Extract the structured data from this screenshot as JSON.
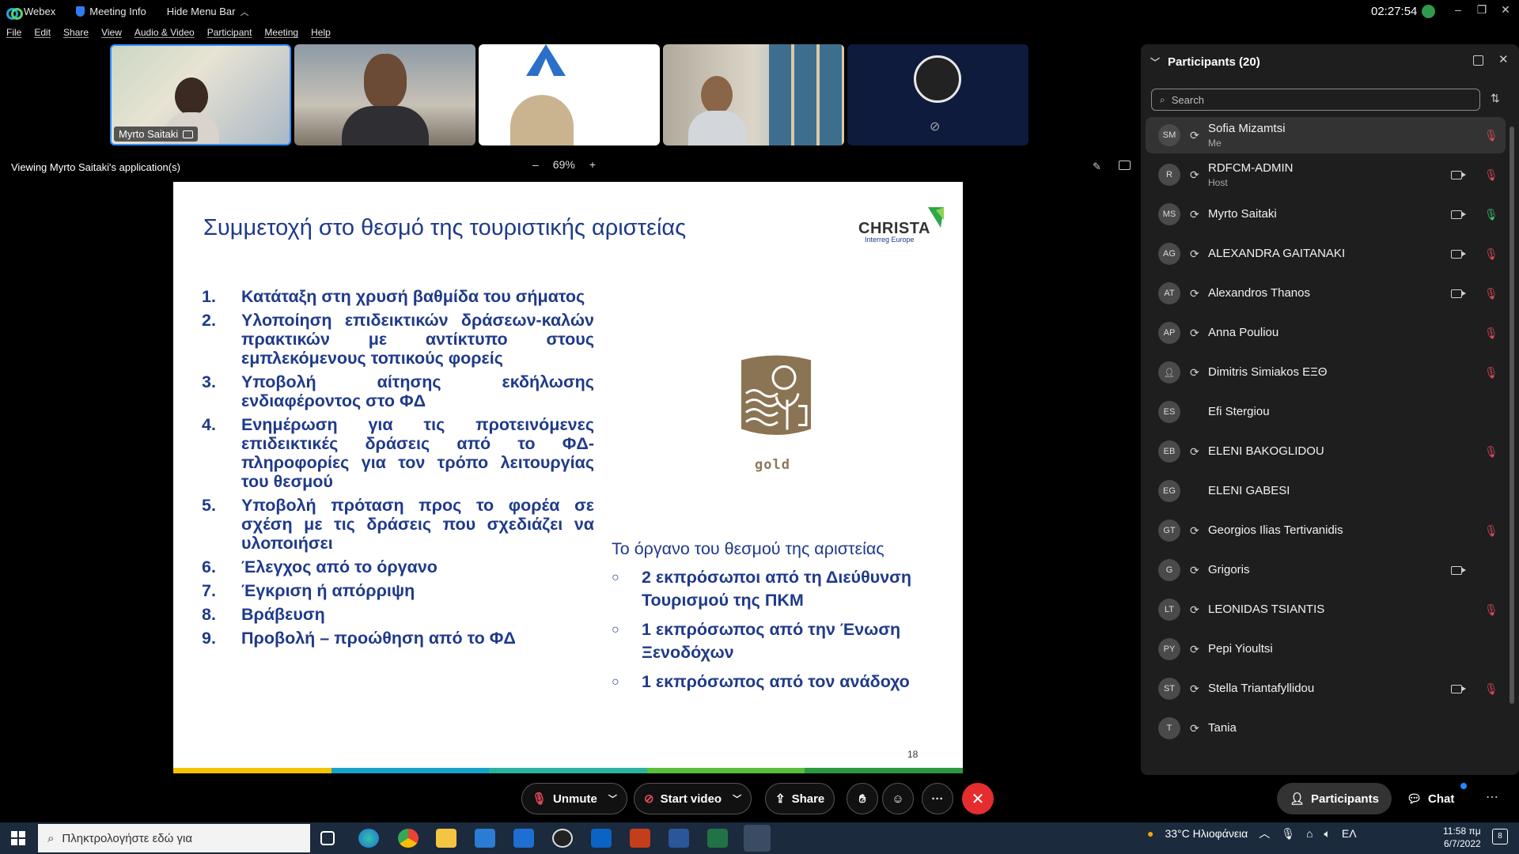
{
  "titlebar": {
    "app_name": "Webex",
    "meeting_info": "Meeting Info",
    "hide_menu": "Hide Menu Bar",
    "clock": "02:27:54",
    "minimize": "–",
    "maximize": "❐",
    "close": "✕"
  },
  "menu": [
    "File",
    "Edit",
    "Share",
    "View",
    "Audio & Video",
    "Participant",
    "Meeting",
    "Help"
  ],
  "video_strip": {
    "active_name": "Myrto Saitaki"
  },
  "share": {
    "viewing_text": "Viewing Myrto Saitaki's application(s)",
    "zoom_minus": "–",
    "zoom_level": "69%",
    "zoom_plus": "+"
  },
  "slide": {
    "title": "Συμμετοχή στο θεσμό της τουριστικής αριστείας",
    "logo_text": "CHRISTA",
    "logo_sub": "Interreg Europe",
    "steps": [
      {
        "num": "1.",
        "text": "Κατάταξη στη χρυσή βαθμίδα του σήματος"
      },
      {
        "num": "2.",
        "text": "Υλοποίηση επιδεικτικών δράσεων-καλών πρακτικών με αντίκτυπο στους εμπλεκόμενους τοπικούς φορείς"
      },
      {
        "num": "3.",
        "text": "Υποβολή αίτησης εκδήλωσης ενδιαφέροντος στο ΦΔ"
      },
      {
        "num": "4.",
        "text": "Ενημέρωση για τις προτεινόμενες επιδεικτικές δράσεις από το ΦΔ-πληροφορίες για τον τρόπο λειτουργίας του θεσμού"
      },
      {
        "num": "5.",
        "text": "Υποβολή πρόταση προς το φορέα σε σχέση με τις δράσεις που σχεδιάζει να υλοποιήσει"
      },
      {
        "num": "6.",
        "text": "Έλεγχος από το όργανο"
      },
      {
        "num": "7.",
        "text": "Έγκριση ή απόρριψη"
      },
      {
        "num": "8.",
        "text": "Βράβευση"
      },
      {
        "num": "9.",
        "text": "Προβολή – προώθηση από το ΦΔ"
      }
    ],
    "badge_label": "gold",
    "organ_title": "Το όργανο του θεσμού της αριστείας",
    "organ_items": [
      "2 εκπρόσωποι από τη Διεύθυνση Τουρισμού της ΠΚΜ",
      "1 εκπρόσωπος από την Ένωση Ξενοδόχων",
      "1 εκπρόσωπος από τον ανάδοχο"
    ],
    "bullet": "○",
    "page_number": "18",
    "bar_colors": [
      "#f5c400",
      "#1aa3c8",
      "#2bb3a0",
      "#5bbf3a",
      "#2e9a3f"
    ]
  },
  "participants": {
    "header": "Participants (20)",
    "search_placeholder": "Search",
    "list": [
      {
        "initials": "SM",
        "name": "Sofia Mizamtsi",
        "role": "Me",
        "sync": true,
        "cam": false,
        "mic": "muted"
      },
      {
        "initials": "R",
        "name": "RDFCM-ADMIN",
        "role": "Host",
        "sync": true,
        "cam": true,
        "mic": "muted"
      },
      {
        "initials": "MS",
        "name": "Myrto Saitaki",
        "role": "",
        "sync": true,
        "cam": true,
        "mic": "on"
      },
      {
        "initials": "AG",
        "name": "ALEXANDRA GAITANAKI",
        "role": "",
        "sync": true,
        "cam": true,
        "mic": "muted"
      },
      {
        "initials": "AT",
        "name": "Alexandros Thanos",
        "role": "",
        "sync": true,
        "cam": true,
        "mic": "muted"
      },
      {
        "initials": "AP",
        "name": "Anna Pouliou",
        "role": "",
        "sync": true,
        "cam": false,
        "mic": "muted"
      },
      {
        "initials": "",
        "name": "Dimitris Simiakos ΕΞΘ",
        "role": "",
        "sync": true,
        "cam": false,
        "mic": "muted"
      },
      {
        "initials": "ES",
        "name": "Efi Stergiou",
        "role": "",
        "sync": false,
        "cam": false,
        "mic": "none"
      },
      {
        "initials": "EB",
        "name": "ELENI BAKOGLIDOU",
        "role": "",
        "sync": true,
        "cam": false,
        "mic": "muted"
      },
      {
        "initials": "EG",
        "name": "ELENI GABESI",
        "role": "",
        "sync": false,
        "cam": false,
        "mic": "none"
      },
      {
        "initials": "GT",
        "name": "Georgios Ilias Tertivanidis",
        "role": "",
        "sync": true,
        "cam": false,
        "mic": "muted"
      },
      {
        "initials": "G",
        "name": "Grigoris",
        "role": "",
        "sync": true,
        "cam": true,
        "mic": "none"
      },
      {
        "initials": "LT",
        "name": "LEONIDAS TSIANTIS",
        "role": "",
        "sync": true,
        "cam": false,
        "mic": "muted"
      },
      {
        "initials": "PY",
        "name": "Pepi Yioultsi",
        "role": "",
        "sync": true,
        "cam": false,
        "mic": "none"
      },
      {
        "initials": "ST",
        "name": "Stella Triantafyllidou",
        "role": "",
        "sync": true,
        "cam": true,
        "mic": "muted"
      },
      {
        "initials": "T",
        "name": "Tania",
        "role": "",
        "sync": true,
        "cam": false,
        "mic": "none"
      }
    ]
  },
  "controls": {
    "unmute": "Unmute",
    "start_video": "Start video",
    "share": "Share",
    "more": "···",
    "end": "✕",
    "participants": "Participants",
    "chat": "Chat"
  },
  "taskbar": {
    "search_placeholder": "Πληκτρολογήστε εδώ για",
    "weather": "33°C Ηλιοφάνεια",
    "lang": "ΕΛ",
    "time": "11:58 πμ",
    "date": "6/7/2022",
    "notif_count": "8"
  },
  "colors": {
    "slide_text": "#1f3a8a",
    "muted_mic": "#e04a5a",
    "live_mic": "#3ec46d",
    "end_call": "#e52d2d"
  }
}
